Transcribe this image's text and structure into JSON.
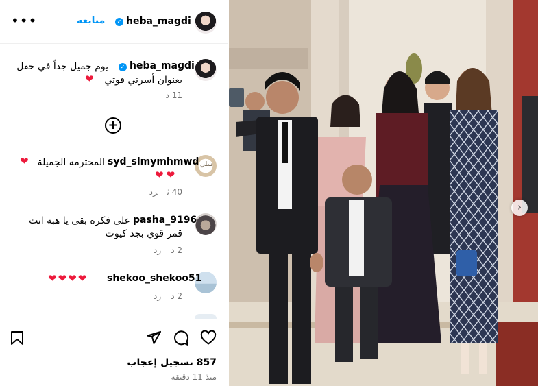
{
  "header": {
    "username": "heba_magdi",
    "follow_label": "متابعة",
    "more_glyph": "•••"
  },
  "caption": {
    "username": "heba_magdi",
    "line1": "يوم جميل جداً في حفل",
    "line2": "بعنوان أسرتي قوتي",
    "time": "11 د"
  },
  "comments": [
    {
      "username": "syd_slmymhmwd",
      "text": "المحترمه الجميلة",
      "time": "40 ث",
      "reply": "رد",
      "avatar_label": "سلي"
    },
    {
      "username": "pasha_9196",
      "line1": "على فكره بقى يا هبه انت",
      "line2": "قمر قوي بجد كيوت",
      "time": "2 د",
      "reply": "رد"
    },
    {
      "username": "shekoo_shekoo51",
      "time": "2 د",
      "reply": "رد"
    }
  ],
  "actions": {
    "likes": "857 تسجيل إعجاب",
    "posted": "منذ 11 دقيقة"
  },
  "icons": [
    "more-icon",
    "verified-icon",
    "add-comment-icon",
    "heart-icon",
    "comment-icon",
    "share-icon",
    "save-icon",
    "next-icon"
  ],
  "colors": {
    "accent": "#0095f6",
    "heart": "#ed1a3c",
    "muted": "#737373"
  }
}
